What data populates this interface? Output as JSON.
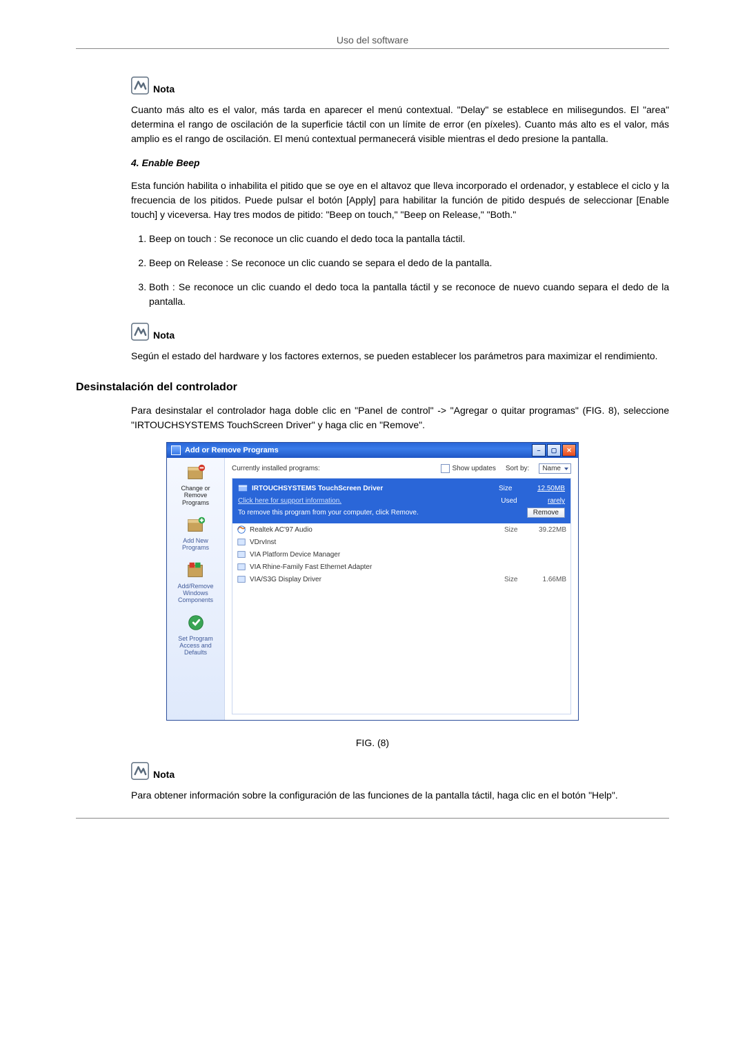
{
  "header": {
    "running": "Uso del software"
  },
  "note_label": "Nota",
  "para_delay": "Cuanto más alto es el valor, más tarda en aparecer el menú contextual. \"Delay\" se establece en milisegundos. El \"area\" determina el rango de oscilación de la superficie táctil con un límite de error (en píxeles). Cuanto más alto es el valor, más amplio es el rango de oscilación. El menú contextual permanecerá visible mientras el dedo presione la pantalla.",
  "sub_enable_beep": "4. Enable Beep",
  "para_beep_intro": "Esta función habilita o inhabilita el pitido que se oye en el altavoz que lleva incorporado el ordenador, y establece el ciclo y la frecuencia de los pitidos. Puede pulsar el botón [Apply] para habilitar la función de pitido después de seleccionar [Enable touch] y viceversa. Hay tres modos de pitido: \"Beep on touch,\" \"Beep on Release,\" \"Both.\"",
  "beep_items": [
    "Beep on touch : Se reconoce un clic cuando el dedo toca la pantalla táctil.",
    "Beep on Release : Se reconoce un clic cuando se separa el dedo de la pantalla.",
    "Both : Se reconoce un clic cuando el dedo toca la pantalla táctil y se reconoce de nuevo cuando separa el dedo de la pantalla."
  ],
  "para_hw_state": "Según el estado del hardware y los factores externos, se pueden establecer los parámetros para maximizar el rendimiento.",
  "h2_uninstall": "Desinstalación del controlador",
  "para_uninstall": "Para desinstalar el controlador haga doble clic en \"Panel de control\" -> \"Agregar o quitar programas\" (FIG. 8), seleccione \"IRTOUCHSYSTEMS TouchScreen Driver\" y haga clic en \"Remove\".",
  "fig_caption": "FIG. (8)",
  "para_help": "Para obtener información sobre la configuración de las funciones de la pantalla táctil, haga clic en el botón \"Help\".",
  "arp": {
    "title": "Add or Remove Programs",
    "toolbar": {
      "currently": "Currently installed programs:",
      "show_updates": "Show updates",
      "sort_by": "Sort by:",
      "sort_value": "Name"
    },
    "sidebar": [
      {
        "label": "Change or Remove Programs"
      },
      {
        "label": "Add New Programs"
      },
      {
        "label": "Add/Remove Windows Components"
      },
      {
        "label": "Set Program Access and Defaults"
      }
    ],
    "selected": {
      "name": "IRTOUCHSYSTEMS TouchScreen Driver",
      "support": "Click here for support information.",
      "remove_hint": "To remove this program from your computer, click Remove.",
      "size_label": "Size",
      "size_value": "12.50MB",
      "used_label": "Used",
      "used_value": "rarely",
      "remove_btn": "Remove"
    },
    "programs": [
      {
        "name": "Realtek AC'97 Audio",
        "size_label": "Size",
        "size": "39.22MB"
      },
      {
        "name": "VDrvInst",
        "size_label": "",
        "size": ""
      },
      {
        "name": "VIA Platform Device Manager",
        "size_label": "",
        "size": ""
      },
      {
        "name": "VIA Rhine-Family Fast Ethernet Adapter",
        "size_label": "",
        "size": ""
      },
      {
        "name": "VIA/S3G Display Driver",
        "size_label": "Size",
        "size": "1.66MB"
      }
    ]
  }
}
